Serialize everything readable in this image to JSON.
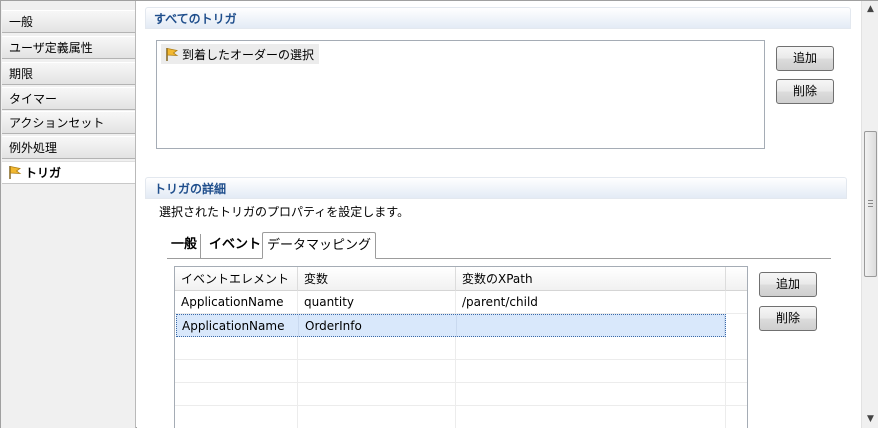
{
  "nav": {
    "items": [
      {
        "label": "一般"
      },
      {
        "label": "ユーザ定義属性"
      },
      {
        "label": "期限"
      },
      {
        "label": "タイマー"
      },
      {
        "label": "アクションセット"
      },
      {
        "label": "例外処理"
      },
      {
        "label": "トリガ",
        "icon": "flag-icon"
      }
    ],
    "active_index": 6
  },
  "all_triggers": {
    "title": "すべてのトリガ",
    "items": [
      {
        "label": "到着したオーダーの選択",
        "icon": "flag-icon"
      }
    ],
    "add_label": "追加",
    "delete_label": "削除"
  },
  "details": {
    "title": "トリガの詳細",
    "description": "選択されたトリガのプロパティを設定します。",
    "tabs": [
      {
        "label": "一般"
      },
      {
        "label": "イベント"
      },
      {
        "label": "データマッピング"
      }
    ],
    "selected_tab": 2,
    "table": {
      "columns": [
        "イベントエレメント",
        "変数",
        "変数のXPath"
      ],
      "rows": [
        [
          "ApplicationName",
          "quantity",
          "/parent/child"
        ],
        [
          "ApplicationName",
          "OrderInfo",
          ""
        ]
      ],
      "selected_row": 1
    },
    "add_label": "追加",
    "delete_label": "削除"
  },
  "colors": {
    "section_title": "#1f4e8c",
    "selection": "#d9e8fb",
    "flag": "#e0a020"
  }
}
